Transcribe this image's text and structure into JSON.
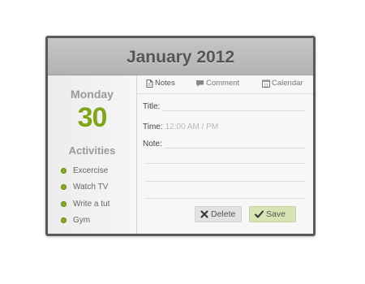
{
  "header": {
    "title": "January 2012"
  },
  "day": {
    "name": "Monday",
    "number": "30"
  },
  "activities": {
    "title": "Activities",
    "items": [
      "Excercise",
      "Watch TV",
      "Write a tut",
      "Gym"
    ]
  },
  "tabs": {
    "notes": "Notes",
    "comment": "Comment",
    "calendar": "Calendar"
  },
  "form": {
    "title_label": "Title:",
    "time_label": "Time:",
    "time_placeholder": "12:00 AM / PM",
    "note_label": "Note:"
  },
  "buttons": {
    "delete": "Delete",
    "save": "Save"
  },
  "colors": {
    "accent_green": "#7fa51a",
    "header_gray": "#b8b8b8",
    "frame": "#5a5a5a",
    "save_bg": "#d7e4b3"
  },
  "icons": [
    "document-icon",
    "comment-icon",
    "calendar-icon",
    "close-icon",
    "check-icon"
  ]
}
